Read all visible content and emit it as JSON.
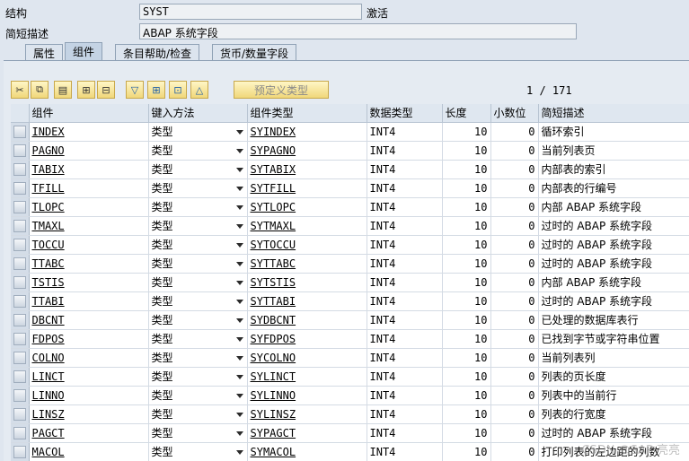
{
  "header": {
    "structure_label": "结构",
    "structure_value": "SYST",
    "status": "激活",
    "desc_label": "简短描述",
    "desc_value": "ABAP 系统字段"
  },
  "tabs": [
    {
      "label": "属性",
      "active": false
    },
    {
      "label": "组件",
      "active": true
    },
    {
      "label": "条目帮助/检查",
      "active": false
    },
    {
      "label": "货币/数量字段",
      "active": false
    }
  ],
  "toolbar": {
    "buttons": [
      "cut-icon",
      "copy-icon",
      "paste-icon",
      "insert-row-icon",
      "delete-row-icon",
      "sort-down-icon",
      "expand-icon",
      "collapse-icon",
      "sort-up-icon"
    ],
    "predefined_type_label": "预定义类型",
    "pager": "1 / 171"
  },
  "columns": [
    "组件",
    "键入方法",
    "组件类型",
    "数据类型",
    "长度",
    "小数位",
    "简短描述"
  ],
  "rows": [
    {
      "component": "INDEX",
      "method": "类型",
      "type": "SYINDEX",
      "dtype": "INT4",
      "length": "10",
      "decimals": "0",
      "desc": "循环索引"
    },
    {
      "component": "PAGNO",
      "method": "类型",
      "type": "SYPAGNO",
      "dtype": "INT4",
      "length": "10",
      "decimals": "0",
      "desc": "当前列表页"
    },
    {
      "component": "TABIX",
      "method": "类型",
      "type": "SYTABIX",
      "dtype": "INT4",
      "length": "10",
      "decimals": "0",
      "desc": "内部表的索引"
    },
    {
      "component": "TFILL",
      "method": "类型",
      "type": "SYTFILL",
      "dtype": "INT4",
      "length": "10",
      "decimals": "0",
      "desc": "内部表的行编号"
    },
    {
      "component": "TLOPC",
      "method": "类型",
      "type": "SYTLOPC",
      "dtype": "INT4",
      "length": "10",
      "decimals": "0",
      "desc": "内部 ABAP 系统字段"
    },
    {
      "component": "TMAXL",
      "method": "类型",
      "type": "SYTMAXL",
      "dtype": "INT4",
      "length": "10",
      "decimals": "0",
      "desc": "过时的 ABAP 系统字段"
    },
    {
      "component": "TOCCU",
      "method": "类型",
      "type": "SYTOCCU",
      "dtype": "INT4",
      "length": "10",
      "decimals": "0",
      "desc": "过时的 ABAP 系统字段"
    },
    {
      "component": "TTABC",
      "method": "类型",
      "type": "SYTTABC",
      "dtype": "INT4",
      "length": "10",
      "decimals": "0",
      "desc": "过时的 ABAP 系统字段"
    },
    {
      "component": "TSTIS",
      "method": "类型",
      "type": "SYTSTIS",
      "dtype": "INT4",
      "length": "10",
      "decimals": "0",
      "desc": "内部 ABAP 系统字段"
    },
    {
      "component": "TTABI",
      "method": "类型",
      "type": "SYTTABI",
      "dtype": "INT4",
      "length": "10",
      "decimals": "0",
      "desc": "过时的 ABAP 系统字段"
    },
    {
      "component": "DBCNT",
      "method": "类型",
      "type": "SYDBCNT",
      "dtype": "INT4",
      "length": "10",
      "decimals": "0",
      "desc": "已处理的数据库表行"
    },
    {
      "component": "FDPOS",
      "method": "类型",
      "type": "SYFDPOS",
      "dtype": "INT4",
      "length": "10",
      "decimals": "0",
      "desc": "已找到字节或字符串位置"
    },
    {
      "component": "COLNO",
      "method": "类型",
      "type": "SYCOLNO",
      "dtype": "INT4",
      "length": "10",
      "decimals": "0",
      "desc": "当前列表列"
    },
    {
      "component": "LINCT",
      "method": "类型",
      "type": "SYLINCT",
      "dtype": "INT4",
      "length": "10",
      "decimals": "0",
      "desc": "列表的页长度"
    },
    {
      "component": "LINNO",
      "method": "类型",
      "type": "SYLINNO",
      "dtype": "INT4",
      "length": "10",
      "decimals": "0",
      "desc": "列表中的当前行"
    },
    {
      "component": "LINSZ",
      "method": "类型",
      "type": "SYLINSZ",
      "dtype": "INT4",
      "length": "10",
      "decimals": "0",
      "desc": "列表的行宽度"
    },
    {
      "component": "PAGCT",
      "method": "类型",
      "type": "SYPAGCT",
      "dtype": "INT4",
      "length": "10",
      "decimals": "0",
      "desc": "过时的 ABAP 系统字段"
    },
    {
      "component": "MACOL",
      "method": "类型",
      "type": "SYMACOL",
      "dtype": "INT4",
      "length": "10",
      "decimals": "0",
      "desc": "打印列表的左边距的列数"
    }
  ],
  "watermark": "CSDN @SAP 亮亮"
}
